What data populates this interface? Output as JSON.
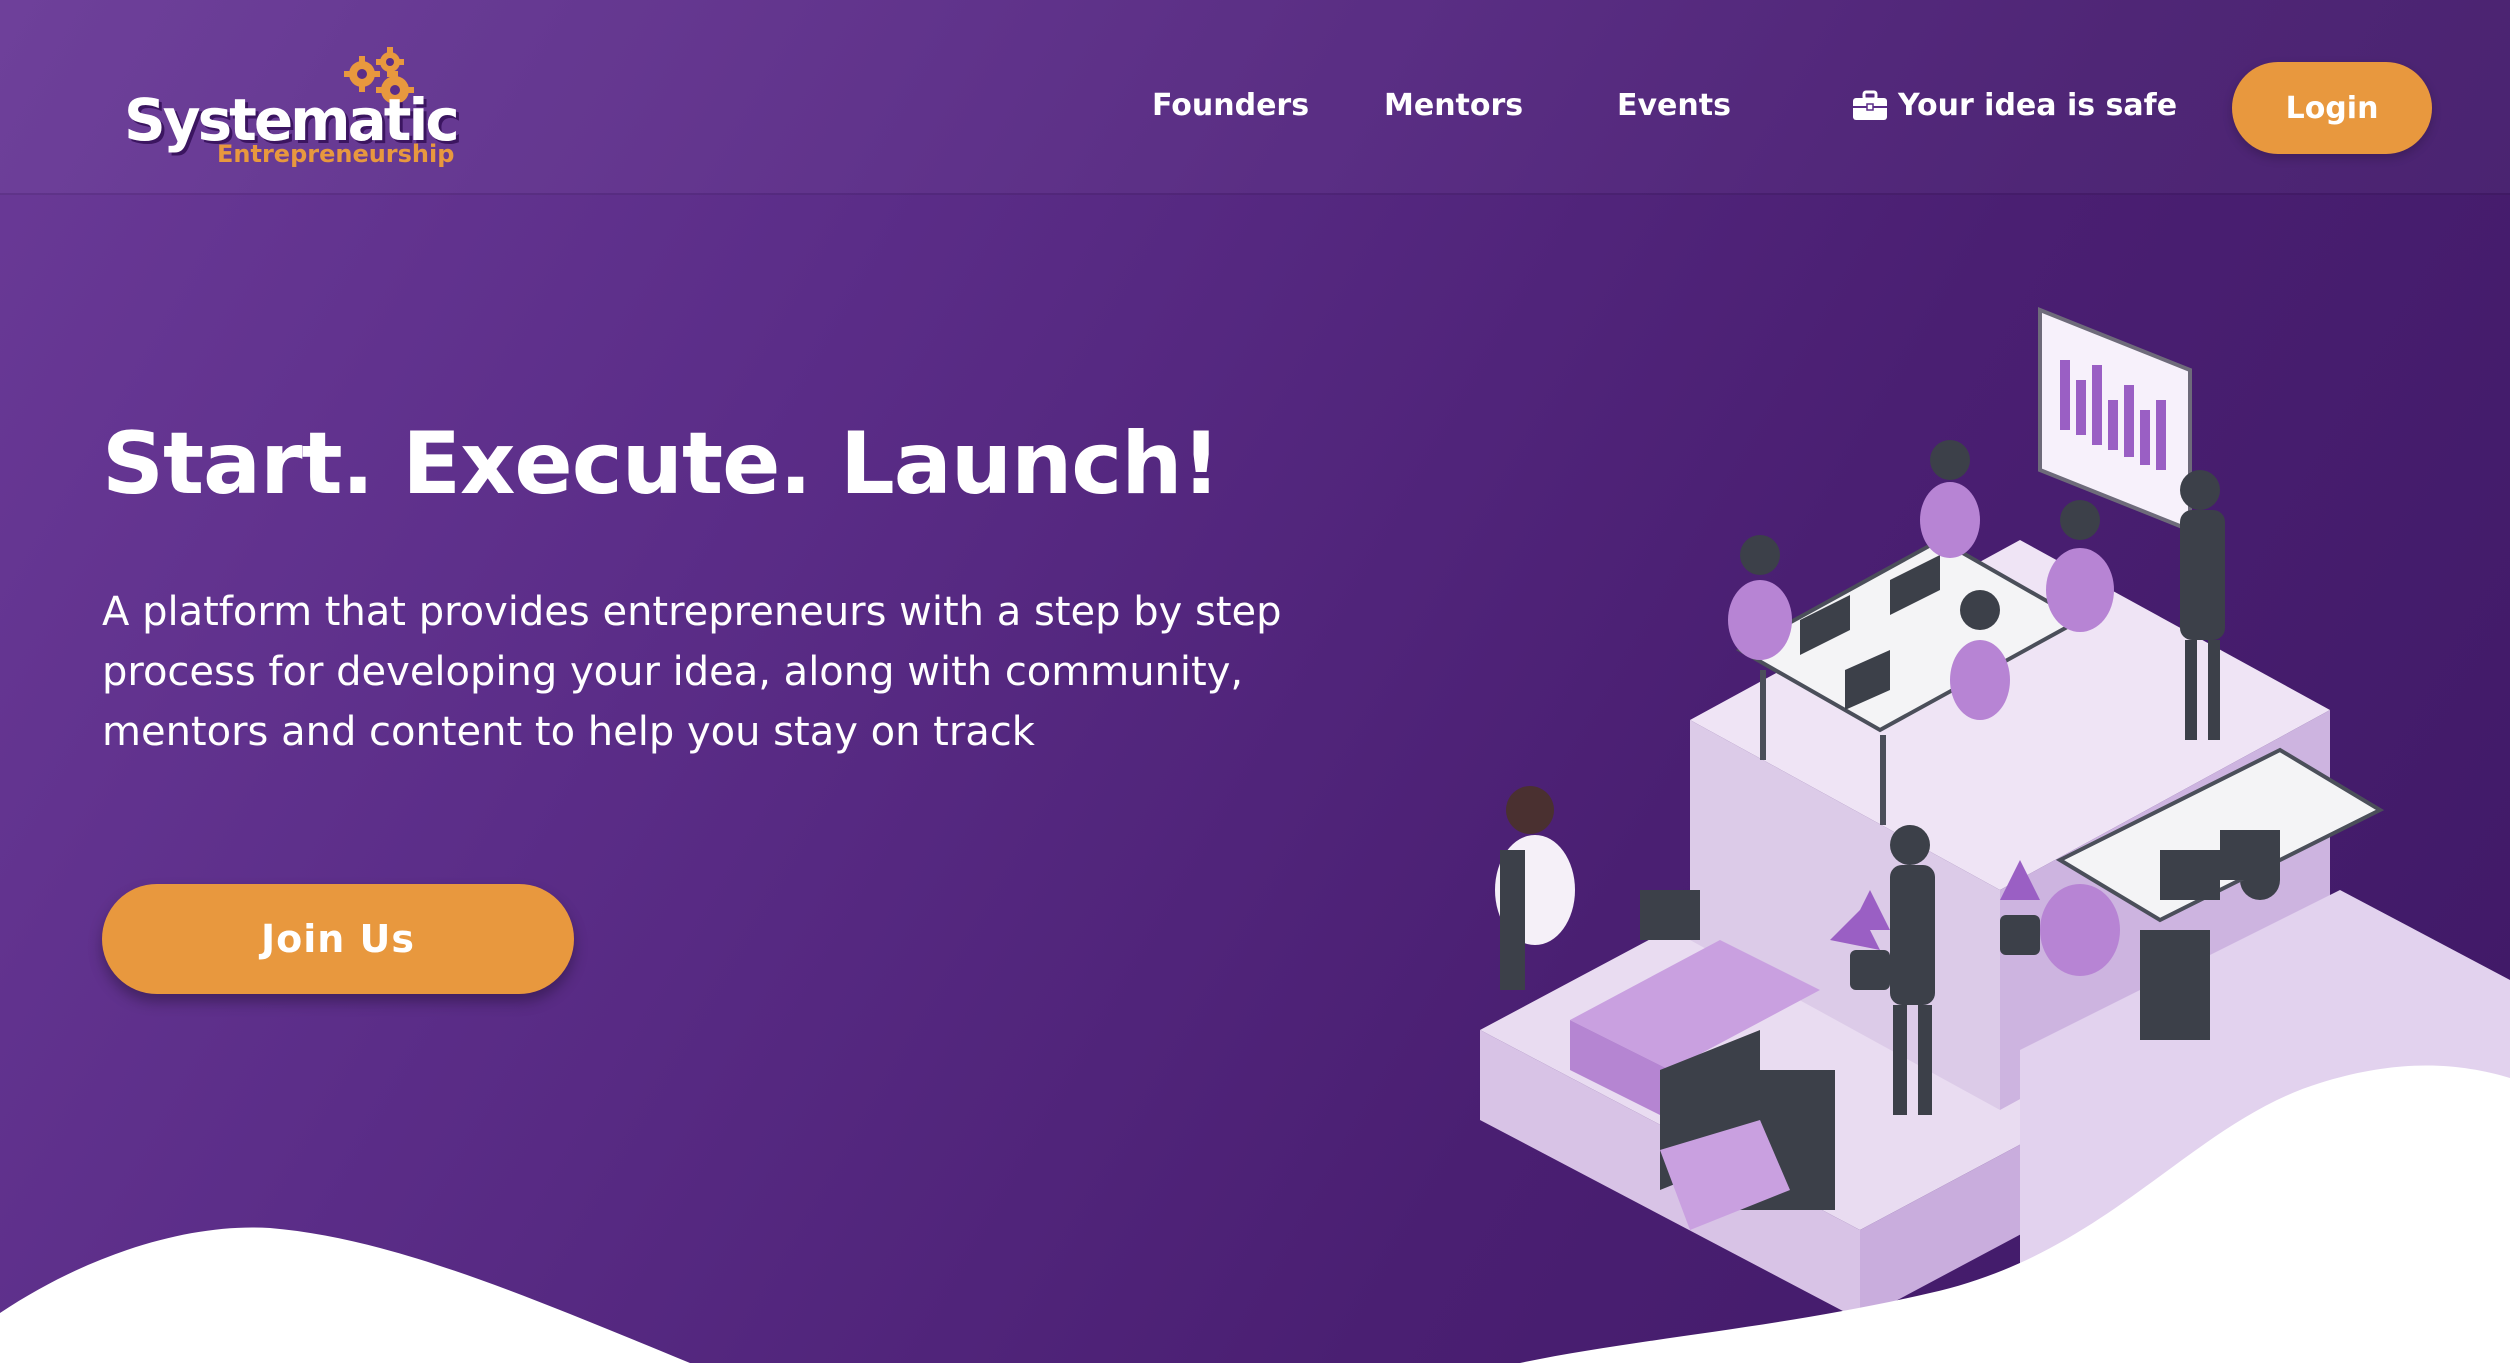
{
  "brand": {
    "title": "Systematic",
    "subtitle": "Entrepreneurship",
    "accent_color": "#e8983e",
    "background_color": "#5b2d88"
  },
  "nav": {
    "links": [
      "Founders",
      "Mentors",
      "Events"
    ],
    "safe_label": "Your idea is safe",
    "safe_icon": "briefcase-icon",
    "login_label": "Login"
  },
  "hero": {
    "title": "Start. Execute. Launch!",
    "description": "A platform that provides entrepreneurs with a step by step process for developing your idea, along with community, mentors and content to help you stay on track",
    "cta_label": "Join Us",
    "illustration": "isometric-office-illustration"
  }
}
